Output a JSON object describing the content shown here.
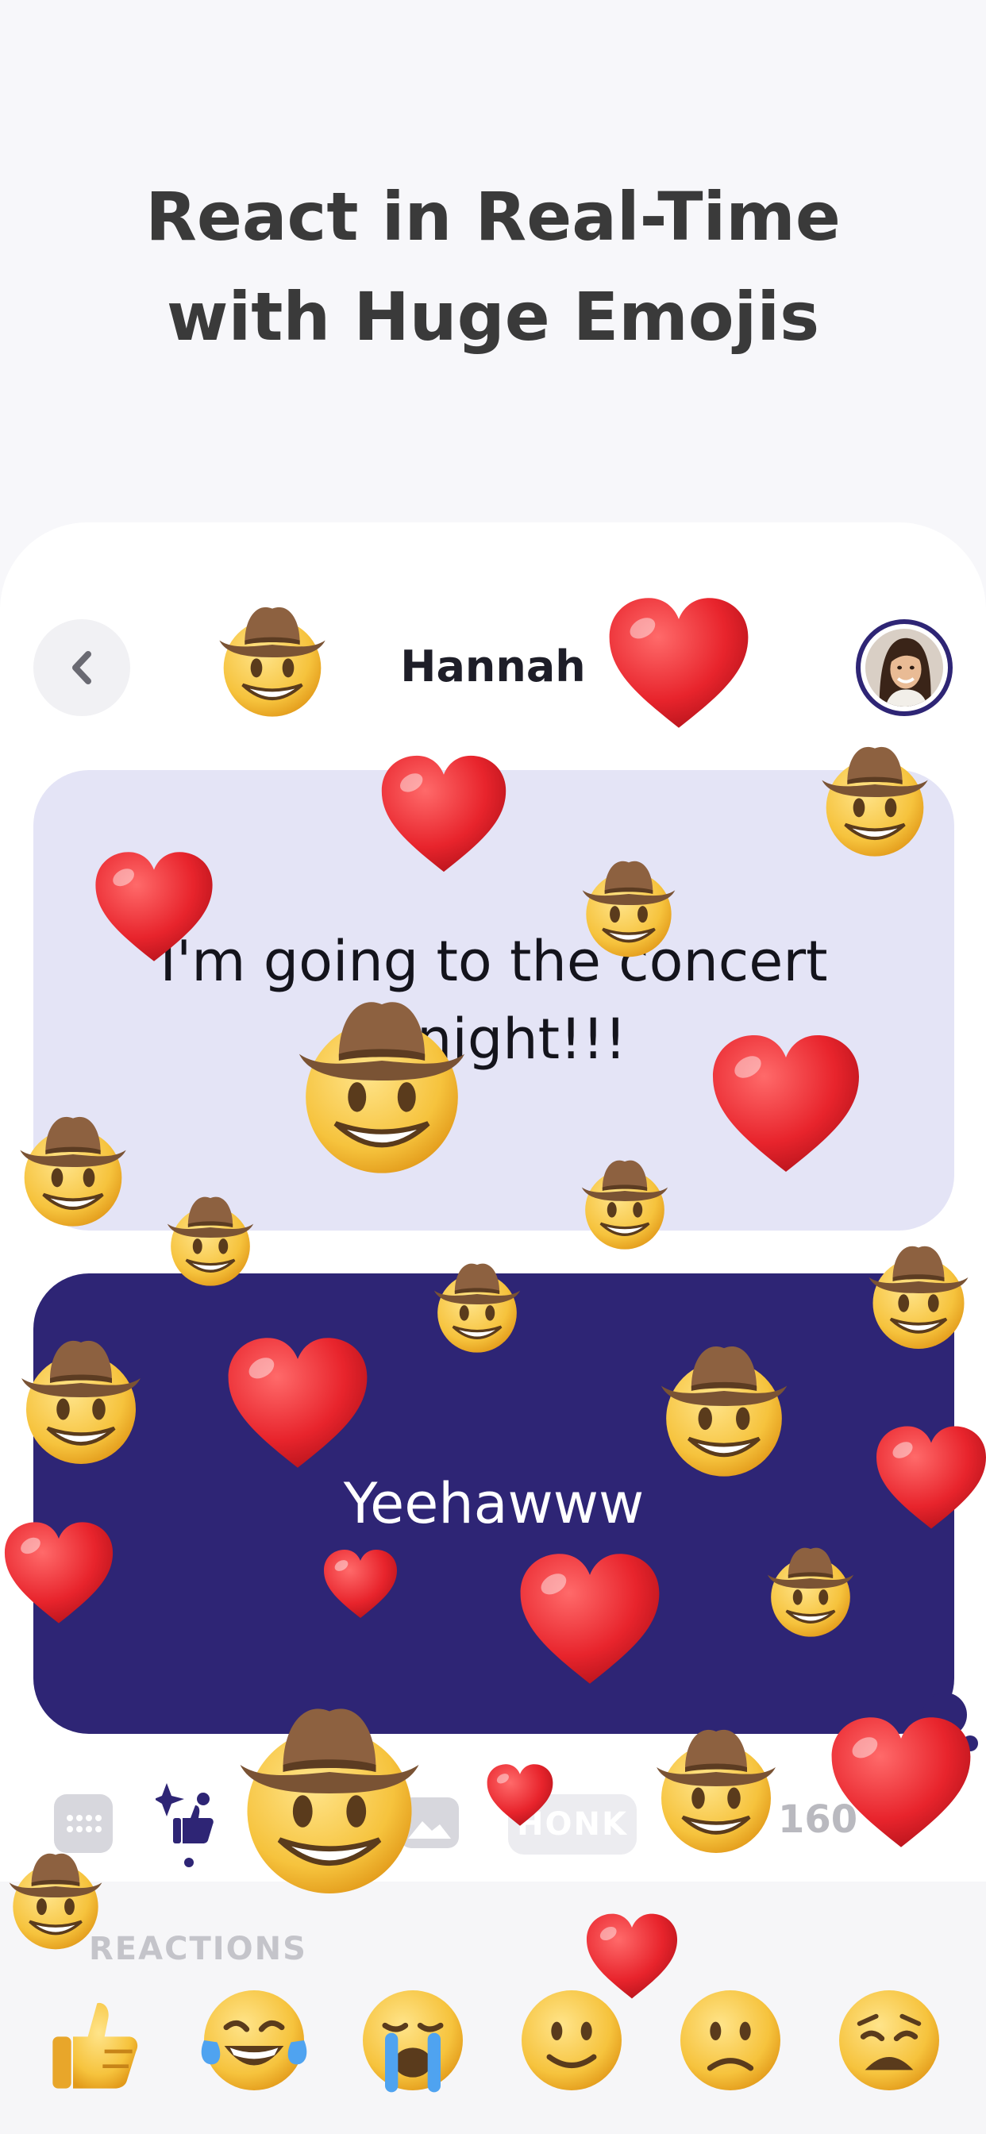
{
  "headline": {
    "line1": "React in Real-Time",
    "line2": "with Huge Emojis"
  },
  "chat": {
    "contact_name": "Hannah",
    "messages": [
      {
        "direction": "incoming",
        "text": "I'm going to the concert tonight!!!"
      },
      {
        "direction": "outgoing",
        "text": "Yeehawww"
      }
    ]
  },
  "toolbar": {
    "honk_label": "HONK",
    "count_text": "160"
  },
  "reactions": {
    "title": "REACTIONS",
    "items": [
      {
        "name": "thumbs-up-emoji"
      },
      {
        "name": "tears-of-joy-emoji"
      },
      {
        "name": "crying-emoji"
      },
      {
        "name": "slightly-smiling-emoji"
      },
      {
        "name": "slightly-frowning-emoji"
      },
      {
        "name": "weary-emoji"
      }
    ]
  },
  "colors": {
    "accent": "#2e2575",
    "incoming_bubble": "#e4e4f6",
    "heart": "#e8242c",
    "emoji_yellow": "#f6c33d"
  },
  "effects": {
    "floating_emojis": [
      "cowboy-emoji",
      "red-heart-emoji"
    ]
  }
}
